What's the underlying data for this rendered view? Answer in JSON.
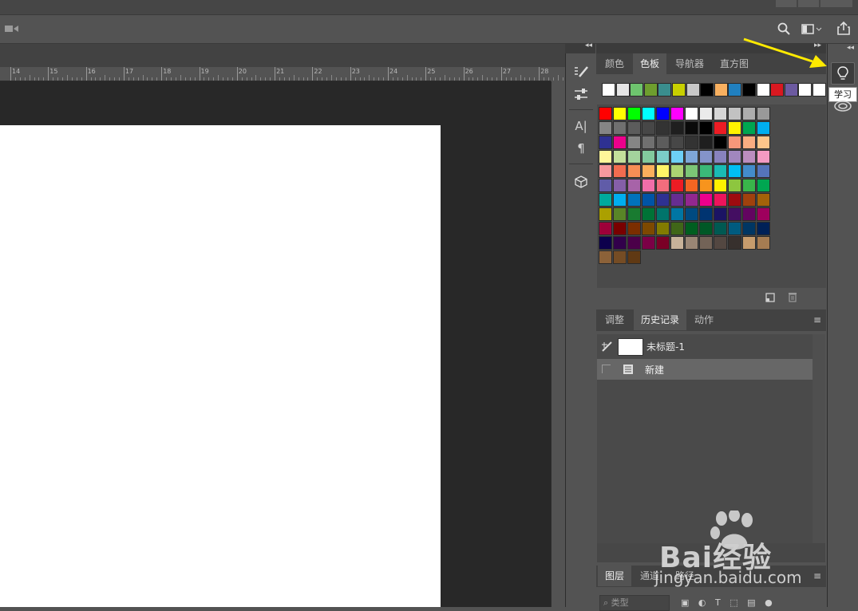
{
  "ruler": {
    "labels": [
      "14",
      "15",
      "16",
      "17",
      "18",
      "19",
      "20",
      "21",
      "22",
      "23",
      "24",
      "25",
      "26",
      "27",
      "28"
    ]
  },
  "swatches_panel": {
    "tabs": [
      "颜色",
      "色板",
      "导航器",
      "直方图"
    ],
    "active_tab": "色板",
    "recent_colors": [
      "#ffffff",
      "#e5e5e5",
      "#6ec46e",
      "#6e9e2e",
      "#3a8e8e",
      "#c8d000",
      "#c8c8c8",
      "#000000",
      "#f8b060",
      "#2080c0",
      "#000000",
      "#ffffff",
      "#d81820",
      "#6c5aa0",
      "#ffffff",
      "#ffffff"
    ],
    "grid": [
      [
        "#ff0000",
        "#ffff00",
        "#00ff00",
        "#00ffff",
        "#0000ff",
        "#ff00ff",
        "#ffffff",
        "#ebebeb",
        "#d6d6d6",
        "#c2c2c2",
        "#adadad",
        "#999999"
      ],
      [
        "#858585",
        "#707070",
        "#5c5c5c",
        "#474747",
        "#333333",
        "#1f1f1f",
        "#0a0a0a",
        "#000000",
        "#ed1c24",
        "#fff200",
        "#00a651",
        "#00aeef"
      ],
      [
        "#2e3192",
        "#ec008c",
        "#858585",
        "#707070",
        "#5c5c5c",
        "#474747",
        "#333333",
        "#1f1f1f",
        "#000000",
        "#f7977a",
        "#f9ad81",
        "#fdc68a"
      ],
      [
        "#fff79a",
        "#c4df9b",
        "#a3d39c",
        "#82ca9d",
        "#7bcdc8",
        "#6dcff6",
        "#7ea7d8",
        "#8493ca",
        "#8882be",
        "#a187be",
        "#bc8dbf",
        "#f49ac2"
      ],
      [
        "#f6989d",
        "#f26c4f",
        "#f68e55",
        "#fbaf5c",
        "#fff467",
        "#acd372",
        "#7cc576",
        "#3bb878",
        "#1abbb4",
        "#00bff3",
        "#438ccb",
        "#5574b9"
      ],
      [
        "#605ca8",
        "#855fa8",
        "#a763a8",
        "#f06ea9",
        "#f26d7d",
        "#ed1c24",
        "#f26522",
        "#f7941d",
        "#fff200",
        "#8dc63f",
        "#39b54a",
        "#00a651"
      ],
      [
        "#00a99d",
        "#00aeef",
        "#0072bc",
        "#0054a6",
        "#2e3192",
        "#662d91",
        "#92278f",
        "#ec008c",
        "#ed145b",
        "#9e0b0f",
        "#a0410d",
        "#a36209"
      ],
      [
        "#aba000",
        "#598527",
        "#197b30",
        "#007236",
        "#00746b",
        "#0076a3",
        "#004a80",
        "#003471",
        "#1b1464",
        "#440e62",
        "#630460",
        "#9e005d"
      ],
      [
        "#9e0039",
        "#790000",
        "#7b2e00",
        "#7d4900",
        "#827b00",
        "#406618",
        "#005e20",
        "#005826",
        "#005952",
        "#005b7f",
        "#003663",
        "#002157"
      ],
      [
        "#0d004c",
        "#32004b",
        "#4b0049",
        "#7b0046",
        "#7a0026",
        "#c7b299",
        "#998675",
        "#736357",
        "#534741",
        "#37302d",
        "#c69c6d",
        "#a67c52"
      ],
      [
        "#8c6239",
        "#754c24",
        "#603913"
      ]
    ]
  },
  "history_panel": {
    "tabs": [
      "调整",
      "历史记录",
      "动作"
    ],
    "active_tab": "历史记录",
    "snapshot_label": "未标题-1",
    "items": [
      "新建"
    ]
  },
  "layers_panel": {
    "tabs": [
      "图层",
      "通道",
      "路径"
    ],
    "active_tab": "图层",
    "filter_placeholder": "类型"
  },
  "right_strip": {
    "tooltip": "学习"
  },
  "watermark": {
    "text": "Bai经验",
    "url": "jingyan.baidu.com"
  }
}
